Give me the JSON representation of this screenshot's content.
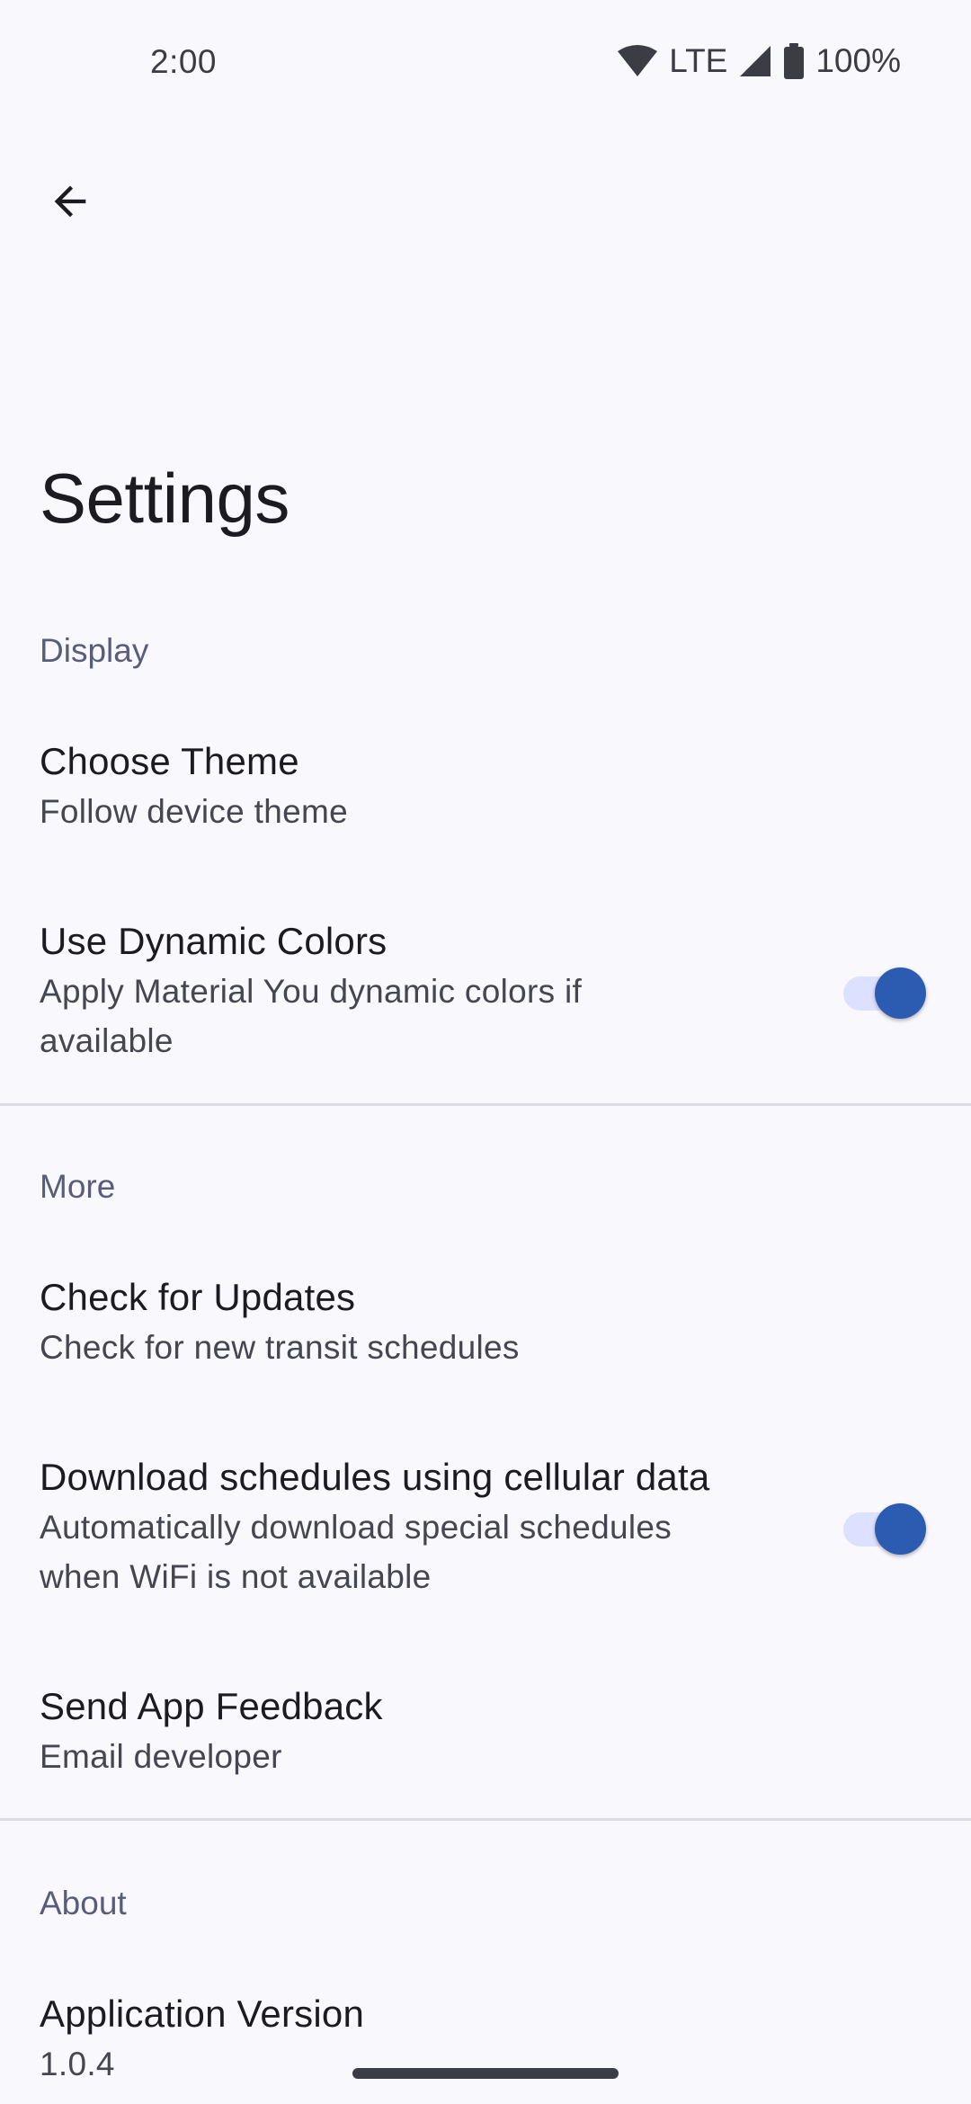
{
  "status_bar": {
    "time": "2:00",
    "network": "LTE",
    "battery": "100%",
    "icons": [
      "wifi-icon",
      "cell-signal-icon",
      "battery-icon"
    ]
  },
  "app_bar": {
    "back_icon": "arrow-back-icon"
  },
  "page": {
    "title": "Settings"
  },
  "sections": {
    "display": {
      "header": "Display",
      "choose_theme": {
        "title": "Choose Theme",
        "summary": "Follow device theme"
      },
      "dynamic_colors": {
        "title": "Use Dynamic Colors",
        "summary_line1": "Apply Material You dynamic colors if",
        "summary_line2": "available",
        "enabled": true
      }
    },
    "more": {
      "header": "More",
      "check_updates": {
        "title": "Check for Updates",
        "summary": "Check for new transit schedules"
      },
      "cellular": {
        "title": "Download schedules using cellular data",
        "summary_line1": "Automatically download special schedules",
        "summary_line2": "when WiFi is not available",
        "enabled": true
      },
      "feedback": {
        "title": "Send App Feedback",
        "summary": "Email developer"
      }
    },
    "about": {
      "header": "About",
      "version": {
        "title": "Application Version",
        "summary": "1.0.4"
      }
    }
  },
  "colors": {
    "background": "#f8f8fd",
    "accent": "#2c5bb2",
    "switch_track": "#dbe1ff",
    "section_header": "#5a5d7a",
    "divider": "#dcdce2"
  }
}
